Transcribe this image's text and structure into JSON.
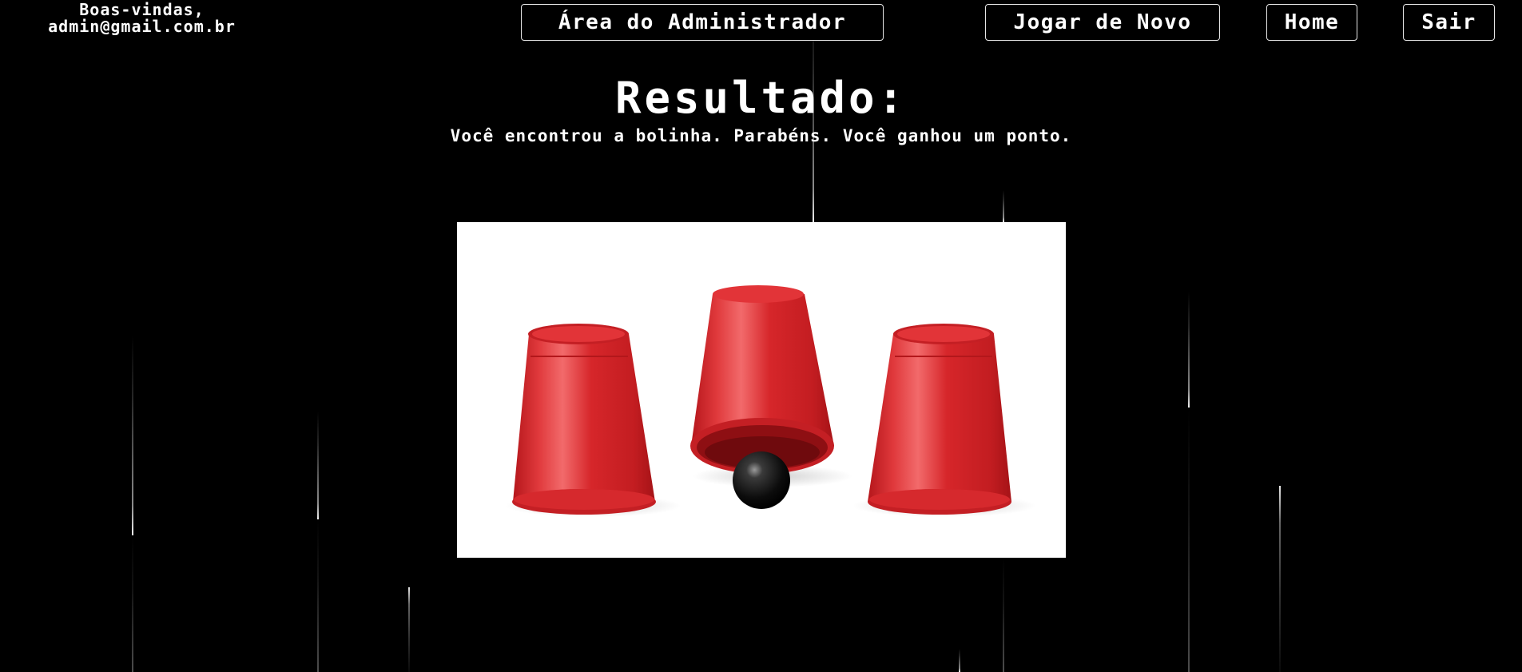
{
  "header": {
    "welcome_line1": "Boas-vindas,",
    "welcome_line2": "admin@gmail.com.br"
  },
  "nav": {
    "admin_label": "Área do Administrador",
    "play_again_label": "Jogar de Novo",
    "home_label": "Home",
    "exit_label": "Sair"
  },
  "result": {
    "title": "Resultado:",
    "message": "Você encontrou a bolinha. Parabéns. Você ganhou um ponto."
  },
  "colors": {
    "background": "#000000",
    "cup_red": "#d9262a",
    "ball": "#111111"
  }
}
